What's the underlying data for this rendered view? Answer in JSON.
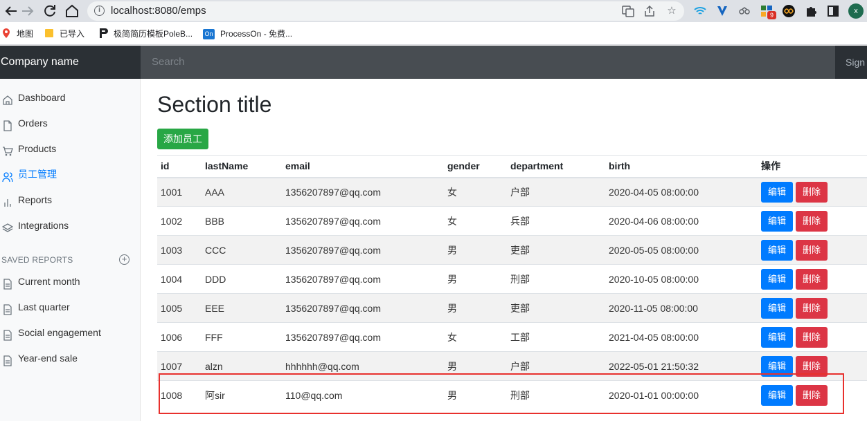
{
  "browser": {
    "url": "localhost:8080/emps",
    "extension_badge": "9",
    "profile_initial": "x",
    "bookmarks": [
      {
        "label": "地图",
        "icon": "maps-pin-icon"
      },
      {
        "label": "已导入",
        "icon": "folder-icon"
      },
      {
        "label": "极简简历模板PoleB...",
        "icon": "poleb-icon"
      },
      {
        "label": "ProcessOn - 免费...",
        "icon": "processon-icon",
        "badge": "On"
      }
    ]
  },
  "navbar": {
    "brand": "Company name",
    "search_placeholder": "Search",
    "signout": "Sign out"
  },
  "sidebar": {
    "items": [
      {
        "label": "Dashboard",
        "icon": "home-icon"
      },
      {
        "label": "Orders",
        "icon": "file-icon"
      },
      {
        "label": "Products",
        "icon": "cart-icon"
      },
      {
        "label": "员工管理",
        "icon": "users-icon",
        "active": true
      },
      {
        "label": "Reports",
        "icon": "bar-chart-icon"
      },
      {
        "label": "Integrations",
        "icon": "layers-icon"
      }
    ],
    "saved_heading": "SAVED REPORTS",
    "saved_items": [
      {
        "label": "Current month"
      },
      {
        "label": "Last quarter"
      },
      {
        "label": "Social engagement"
      },
      {
        "label": "Year-end sale"
      }
    ]
  },
  "main": {
    "title": "Section title",
    "add_button": "添加员工",
    "columns": [
      "id",
      "lastName",
      "email",
      "gender",
      "department",
      "birth",
      "操作"
    ],
    "edit_label": "编辑",
    "delete_label": "删除",
    "rows": [
      [
        "1001",
        "AAA",
        "1356207897@qq.com",
        "女",
        "户部",
        "2020-04-05 08:00:00"
      ],
      [
        "1002",
        "BBB",
        "1356207897@qq.com",
        "女",
        "兵部",
        "2020-04-06 08:00:00"
      ],
      [
        "1003",
        "CCC",
        "1356207897@qq.com",
        "男",
        "吏部",
        "2020-05-05 08:00:00"
      ],
      [
        "1004",
        "DDD",
        "1356207897@qq.com",
        "男",
        "刑部",
        "2020-10-05 08:00:00"
      ],
      [
        "1005",
        "EEE",
        "1356207897@qq.com",
        "男",
        "吏部",
        "2020-11-05 08:00:00"
      ],
      [
        "1006",
        "FFF",
        "1356207897@qq.com",
        "女",
        "工部",
        "2021-04-05 08:00:00"
      ],
      [
        "1007",
        "alzn",
        "hhhhhh@qq.com",
        "男",
        "户部",
        "2022-05-01 21:50:32"
      ],
      [
        "1008",
        "阿sir",
        "110@qq.com",
        "男",
        "刑部",
        "2020-01-01 00:00:00"
      ]
    ]
  },
  "colors": {
    "navbar": "#343a40",
    "add_button": "#28a745",
    "edit_button": "#007bff",
    "delete_button": "#dc3545",
    "highlight": "#e8302d",
    "active_link": "#007bff"
  }
}
